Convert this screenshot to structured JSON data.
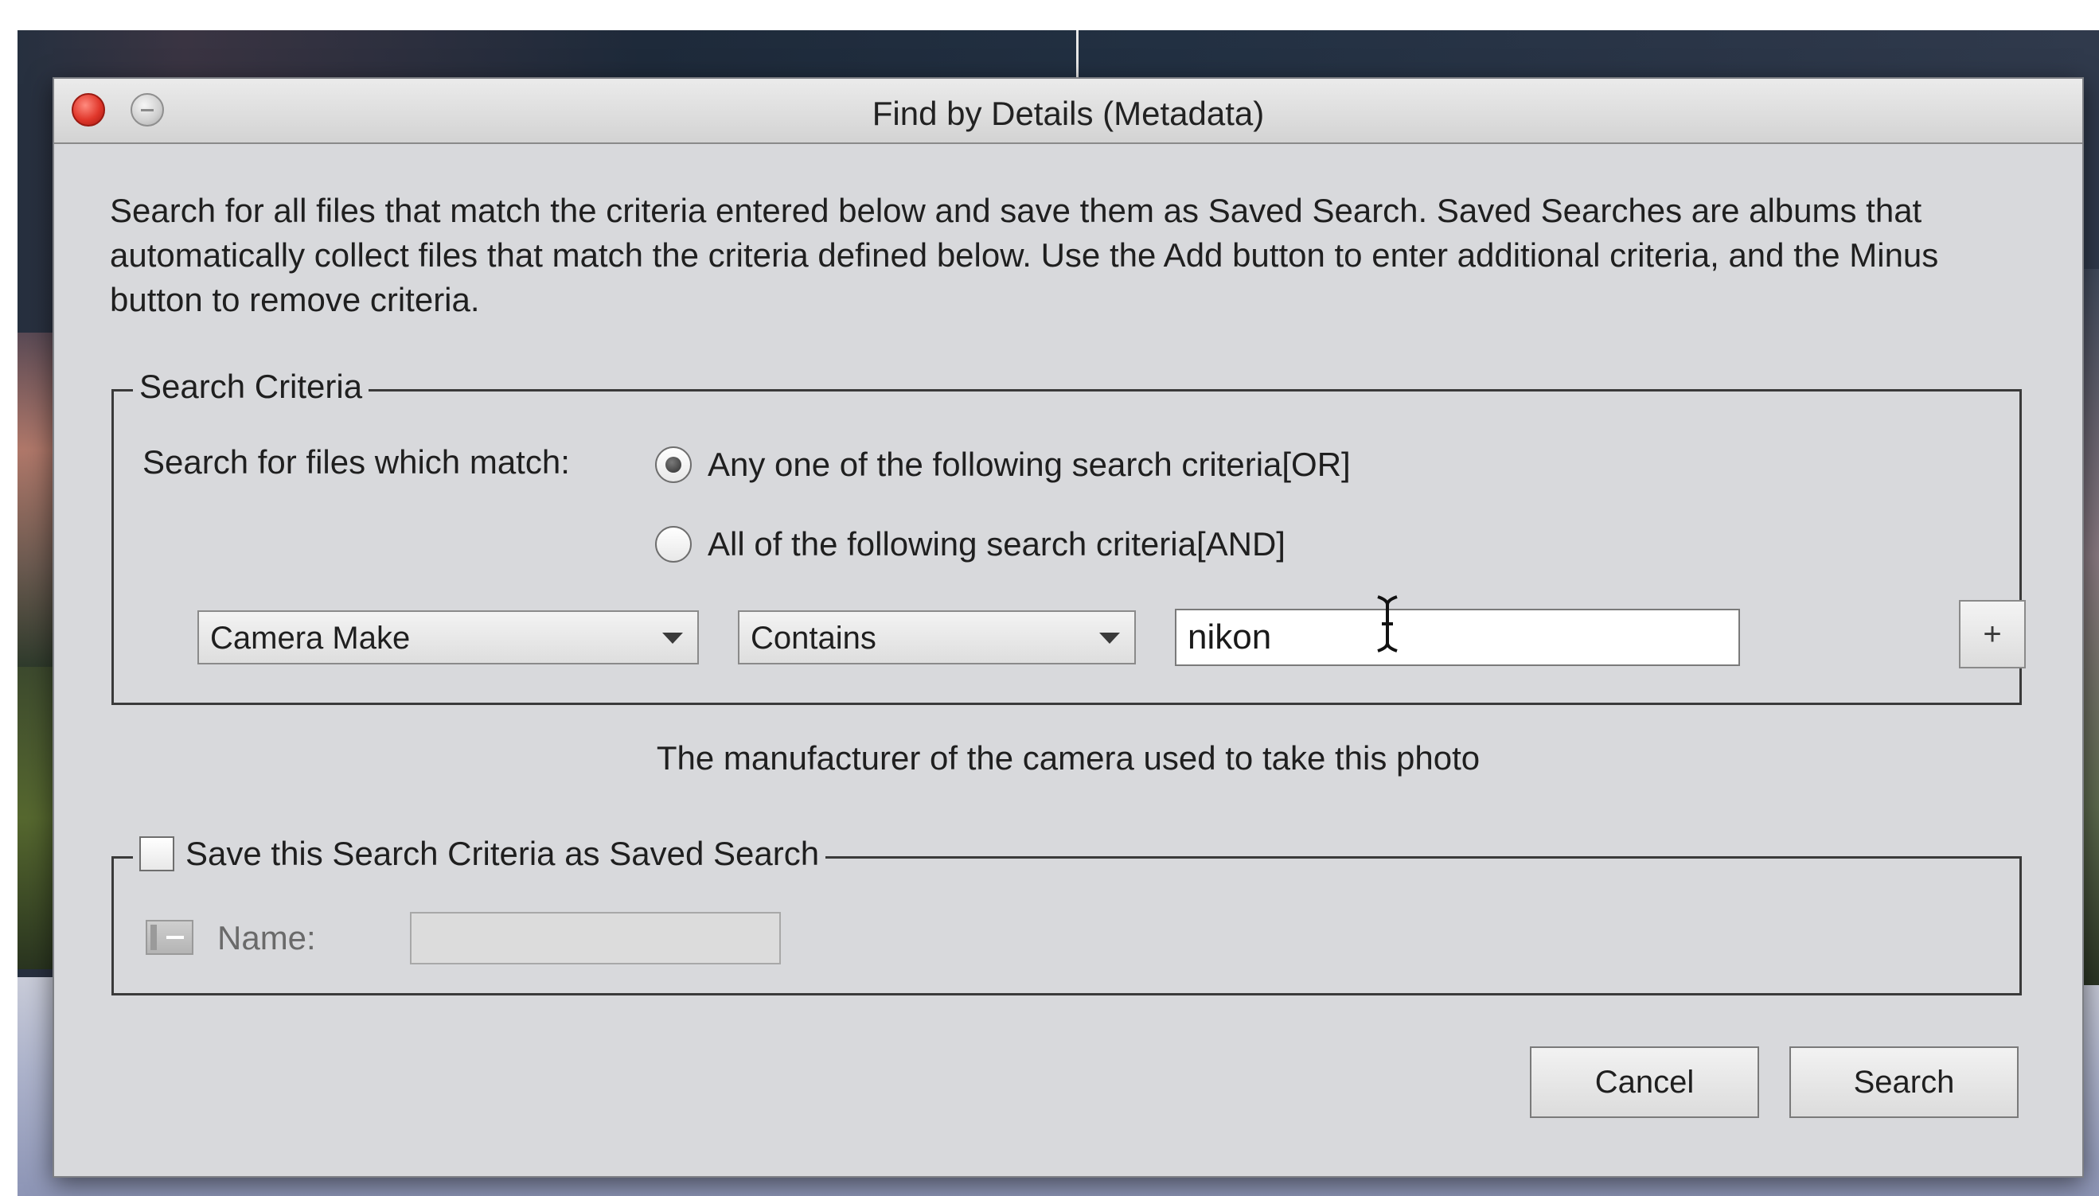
{
  "window": {
    "title": "Find by Details (Metadata)"
  },
  "intro_text": "Search for all files that match the criteria entered below and save them as Saved Search. Saved Searches are albums that automatically collect files that match the criteria defined below. Use the Add button to enter additional criteria, and the Minus button to remove criteria.",
  "criteria": {
    "legend": "Search Criteria",
    "match_label": "Search for files which match:",
    "option_or": "Any one of the following search criteria[OR]",
    "option_and": "All of the following search criteria[AND]",
    "selected_option": "or",
    "field_select": "Camera Make",
    "operator_select": "Contains",
    "value_input": "nikon",
    "add_button": "+",
    "hint": "The manufacturer of the camera used to take this photo"
  },
  "save": {
    "legend": "Save this Search Criteria as Saved Search",
    "checked": false,
    "name_label": "Name:",
    "name_value": ""
  },
  "buttons": {
    "cancel": "Cancel",
    "search": "Search"
  },
  "icons": {
    "close": "close-icon",
    "minimize": "minimize-icon",
    "dropdown": "chevron-down-icon",
    "text_cursor": "i-beam-cursor-icon",
    "name_field": "album-icon"
  }
}
